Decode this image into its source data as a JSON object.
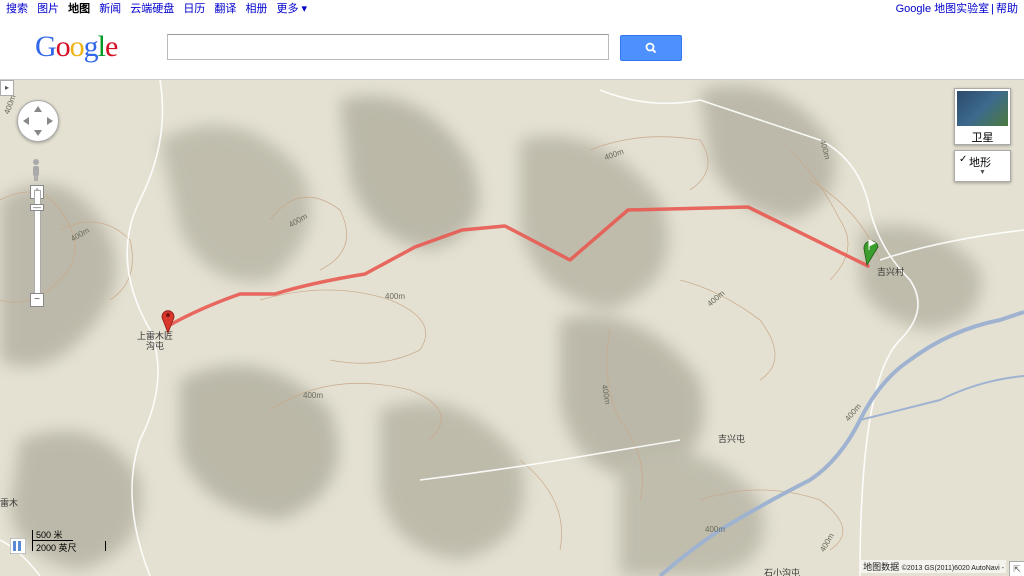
{
  "topbar": {
    "nav": [
      "搜索",
      "图片",
      "地图",
      "新闻",
      "云端硬盘",
      "日历",
      "翻译",
      "相册",
      "更多 ▾"
    ],
    "active_index": 2,
    "labs": "Google 地图实验室",
    "help": "帮助"
  },
  "logo": {
    "letters": [
      "G",
      "o",
      "o",
      "g",
      "l",
      "e"
    ],
    "colors": [
      "#3369e8",
      "#d50f25",
      "#eeb211",
      "#3369e8",
      "#009925",
      "#d50f25"
    ]
  },
  "search": {
    "value": "",
    "placeholder": ""
  },
  "map": {
    "contour_label": "400m",
    "places": {
      "start": "上雷木匠\n沟屯",
      "end": "吉兴村",
      "village": "吉兴屯",
      "edge_left": "雷木",
      "bottom": "石小沟屯"
    },
    "route_color": "#e85a52",
    "start_marker_color": "#d9362c",
    "end_marker_color": "#3a9d2c"
  },
  "controls": {
    "satellite_label": "卫星",
    "terrain_label": "地形",
    "terrain_checked": true,
    "zoom_in": "+",
    "zoom_out": "−"
  },
  "scale": {
    "metric": "500 米",
    "imperial": "2000 英尺"
  },
  "copyright": {
    "text": "地图数据",
    "detail": "©2013 GS(2011)6020 AutoNavi -"
  }
}
